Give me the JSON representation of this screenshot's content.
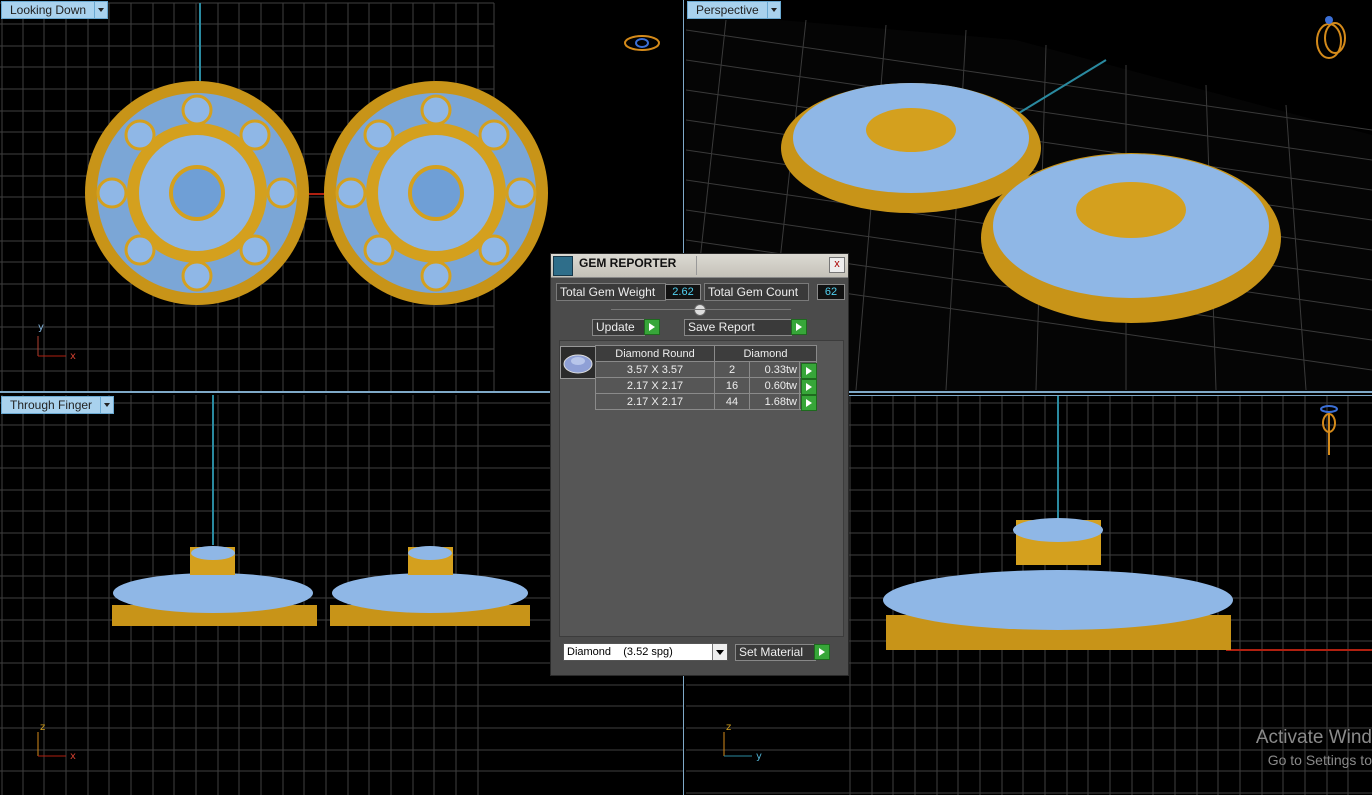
{
  "viewports": {
    "top_left": {
      "label": "Looking Down"
    },
    "top_right": {
      "label": "Perspective"
    },
    "bottom_left": {
      "label": "Through Finger"
    },
    "bottom_right": {
      "label": ""
    }
  },
  "axes": {
    "top_left": {
      "a": "y",
      "b": "x"
    },
    "bottom_left": {
      "a": "z",
      "b": "x"
    },
    "bottom_right": {
      "a": "z",
      "b": "y"
    }
  },
  "gem_reporter": {
    "title": "GEM REPORTER",
    "close": "x",
    "total_weight_label": "Total Gem Weight",
    "total_weight_value": "2.62",
    "total_count_label": "Total Gem Count",
    "total_count_value": "62",
    "update_label": "Update",
    "save_report_label": "Save Report",
    "table_headers": [
      "Diamond Round",
      "Diamond"
    ],
    "rows": [
      {
        "size": "3.57 X 3.57",
        "count": "2",
        "weight": "0.33tw"
      },
      {
        "size": "2.17 X 2.17",
        "count": "16",
        "weight": "0.60tw"
      },
      {
        "size": "2.17 X 2.17",
        "count": "44",
        "weight": "1.68tw"
      }
    ],
    "material_select": "Diamond    (3.52 spg)",
    "set_material_label": "Set Material"
  },
  "watermark": {
    "line1": "Activate Wind",
    "line2": "Go to Settings to"
  },
  "colors": {
    "gold": "#d4a01e",
    "gem": "#8fb7e6",
    "grid": "#4a4a4a",
    "label_bg": "#a9d2ee",
    "accent_green": "#37a639"
  }
}
